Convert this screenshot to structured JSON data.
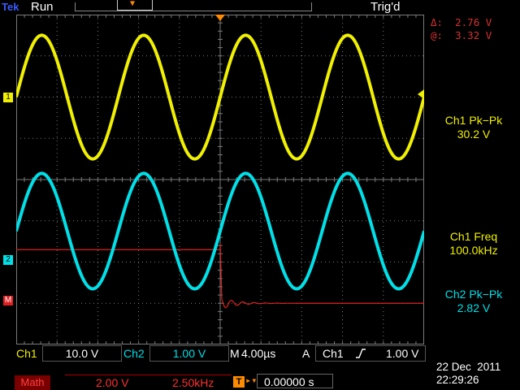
{
  "header": {
    "brand": "Tek",
    "run_state": "Run",
    "trigger_state": "Trig'd"
  },
  "cursors": {
    "delta_label": "Δ:",
    "delta_value": "2.76 V",
    "at_label": "@:",
    "at_value": "3.32 V"
  },
  "measurements": [
    {
      "label": "Ch1 Pk−Pk",
      "value": "30.2 V"
    },
    {
      "label": "Ch1 Freq",
      "value": "100.0kHz"
    },
    {
      "label": "Ch2 Pk−Pk",
      "value": "2.82 V"
    }
  ],
  "markers": {
    "ch1": "1",
    "ch2": "2",
    "math": "M"
  },
  "bottom": {
    "ch1_label": "Ch1",
    "ch1_scale": "10.0 V",
    "ch2_label": "Ch2",
    "ch2_scale": "1.00 V",
    "timebase_label": "M",
    "timebase": "4.00µs",
    "trigger_type": "A",
    "trigger_source": "Ch1",
    "trigger_slope_icon": "rising-edge-icon",
    "trigger_level": "1.00 V",
    "math_label": "Math",
    "math_scale": "2.00 V",
    "math_freq": "2.50kHz",
    "trigger_position": "0.00000 s",
    "date": "22 Dec  2011",
    "time": "22:29:26"
  },
  "colors": {
    "ch1": "#f0f000",
    "ch2": "#00e0e8",
    "math": "#e02020",
    "trigger": "#ff8a00",
    "graticule": "#7a7a7a"
  },
  "waveforms": {
    "ch1": {
      "divisions_peak_to_peak": 3.0,
      "period_divisions": 2.5,
      "center_divisions_from_top": 2.0
    },
    "ch2": {
      "divisions_peak_to_peak": 2.8,
      "period_divisions": 2.5,
      "center_divisions_from_top": 5.25
    },
    "math": {
      "level_divisions_from_top": 7.0
    }
  }
}
